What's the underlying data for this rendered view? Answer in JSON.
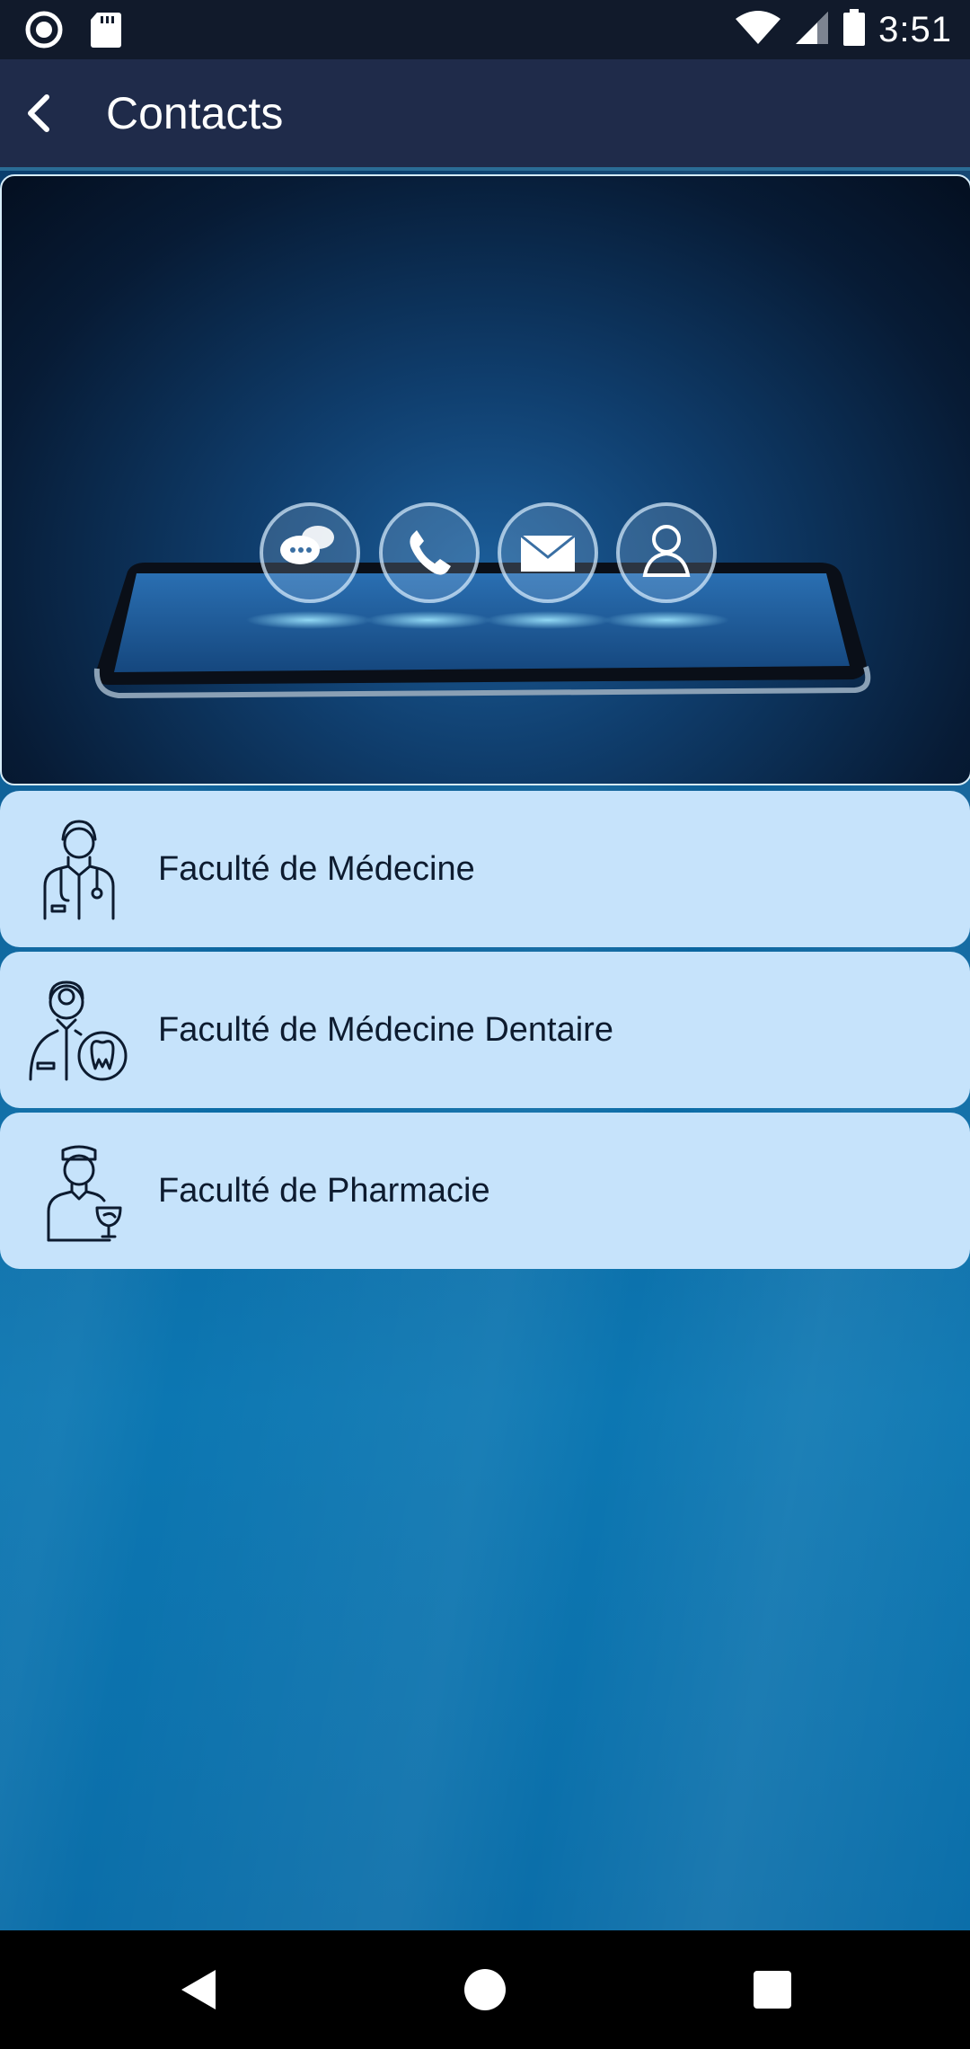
{
  "status_bar": {
    "time": "3:51",
    "icons": [
      "record-icon",
      "sd-card-icon",
      "wifi-icon",
      "signal-icon",
      "battery-icon"
    ]
  },
  "app_bar": {
    "title": "Contacts",
    "back_icon": "back-arrow-icon"
  },
  "banner": {
    "description_icons": [
      "chat-icon",
      "phone-icon",
      "mail-icon",
      "person-icon"
    ]
  },
  "faculties": [
    {
      "label": "Faculté de Médecine",
      "icon": "doctor-icon"
    },
    {
      "label": "Faculté de Médecine Dentaire",
      "icon": "dentist-icon"
    },
    {
      "label": "Faculté de Pharmacie",
      "icon": "pharmacist-icon"
    }
  ],
  "nav_bar": {
    "buttons": [
      "back-nav-icon",
      "home-nav-icon",
      "recents-nav-icon"
    ]
  },
  "colors": {
    "app_bar": "#1f2b4a",
    "status_bar": "#111a2b",
    "list_item": "#c6e3fb",
    "list_text": "#0d1b2f",
    "background": "#0b6ea9"
  }
}
